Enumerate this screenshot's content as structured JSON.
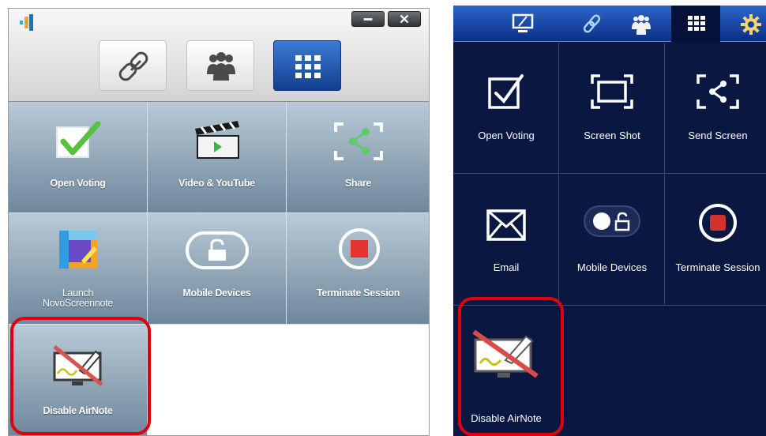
{
  "desktop": {
    "window_buttons": [
      "minimize",
      "close"
    ],
    "tabs": [
      {
        "icon": "link-icon"
      },
      {
        "icon": "group-icon"
      },
      {
        "icon": "grid-icon",
        "active": true
      }
    ],
    "tiles": [
      {
        "label": "Open Voting",
        "icon": "checkbox-icon"
      },
      {
        "label": "Video & YouTube",
        "icon": "clapperboard-icon"
      },
      {
        "label": "Share",
        "icon": "share-icon"
      },
      {
        "label": "Launch\nNovoScreennote",
        "icon": "screennote-icon"
      },
      {
        "label": "Mobile Devices",
        "icon": "unlock-icon"
      },
      {
        "label": "Terminate Session",
        "icon": "stop-icon"
      },
      {
        "label": "Disable AirNote",
        "icon": "airnote-disabled-icon"
      }
    ]
  },
  "mobile": {
    "tabs": [
      {
        "icon": "monitor-icon"
      },
      {
        "icon": "link-icon"
      },
      {
        "icon": "group-icon"
      },
      {
        "icon": "grid-icon",
        "active": true
      },
      {
        "icon": "gear-icon"
      }
    ],
    "tiles": [
      {
        "label": "Open Voting",
        "icon": "checkbox-icon"
      },
      {
        "label": "Screen Shot",
        "icon": "screenshot-icon"
      },
      {
        "label": "Send Screen",
        "icon": "send-screen-icon"
      },
      {
        "label": "Email",
        "icon": "envelope-icon"
      },
      {
        "label": "Mobile Devices",
        "icon": "toggle-lock-icon"
      },
      {
        "label": "Terminate Session",
        "icon": "stop-icon"
      },
      {
        "label": "Disable AirNote",
        "icon": "airnote-disabled-icon"
      }
    ]
  },
  "colors": {
    "highlight": "#e0000d",
    "desktop_tile": "#8aa2b5",
    "mobile_bg": "#091640",
    "active_tab": "#1a4fa8"
  }
}
